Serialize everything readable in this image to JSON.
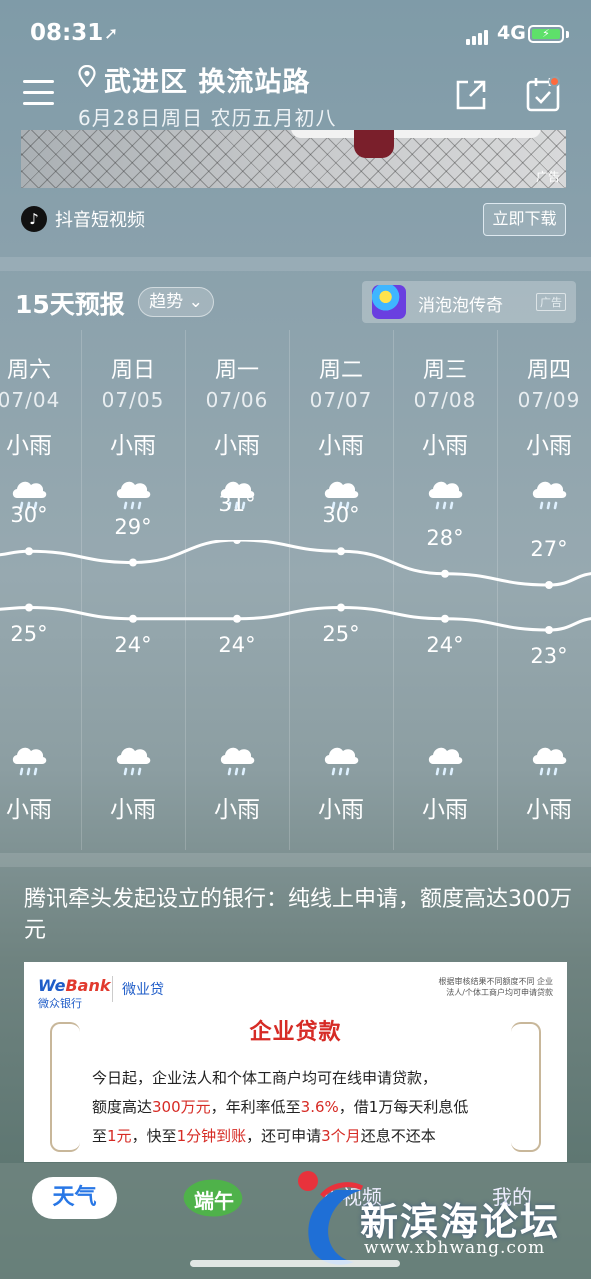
{
  "status_bar": {
    "time": "08:31",
    "network": "4G"
  },
  "header": {
    "location": "武进区 换流站路",
    "date_line": "6月28日周日 农历五月初八"
  },
  "ad_banner": {
    "ad_tag": "广告",
    "source_name": "抖音短视频",
    "download_label": "立即下载"
  },
  "forecast": {
    "title": "15天预报",
    "trend_label": "趋势",
    "game_ad": {
      "name": "消泡泡传奇",
      "ad_label": "广告"
    },
    "days": [
      {
        "weekday": "周六",
        "date": "07/04",
        "day_cond": "小雨",
        "night_cond": "小雨",
        "high": "30°",
        "low": "25°"
      },
      {
        "weekday": "周日",
        "date": "07/05",
        "day_cond": "小雨",
        "night_cond": "小雨",
        "high": "29°",
        "low": "24°"
      },
      {
        "weekday": "周一",
        "date": "07/06",
        "day_cond": "小雨",
        "night_cond": "小雨",
        "high": "31°",
        "low": "24°"
      },
      {
        "weekday": "周二",
        "date": "07/07",
        "day_cond": "小雨",
        "night_cond": "小雨",
        "high": "30°",
        "low": "25°"
      },
      {
        "weekday": "周三",
        "date": "07/08",
        "day_cond": "小雨",
        "night_cond": "小雨",
        "high": "28°",
        "low": "24°"
      },
      {
        "weekday": "周四",
        "date": "07/09",
        "day_cond": "小雨",
        "night_cond": "小雨",
        "high": "27°",
        "low": "23°"
      }
    ]
  },
  "chart_data": {
    "type": "line",
    "categories": [
      "07/04",
      "07/05",
      "07/06",
      "07/07",
      "07/08",
      "07/09"
    ],
    "series": [
      {
        "values": [
          30,
          29,
          31,
          30,
          28,
          27
        ]
      },
      {
        "values": [
          25,
          24,
          24,
          25,
          24,
          23
        ]
      }
    ],
    "ylim": [
      23,
      31
    ]
  },
  "news": {
    "title": "腾讯牵头发起设立的银行：纯线上申请，额度高达300万元",
    "card": {
      "brand_en_a": "We",
      "brand_en_b": "Bank",
      "brand_cn": "微众银行",
      "product": "微业贷",
      "note": "根据审核结果不同额度不同 企业法人/个体工商户均可申请贷款",
      "headline": "企业贷款",
      "body_1": "今日起，企业法人和个体工商户均可在线申请贷款，",
      "body_2a": "额度高达",
      "body_2b": "300万元",
      "body_2c": "，年利率低至",
      "body_2d": "3.6%",
      "body_2e": "，借1万每天利息低",
      "body_3a": "至",
      "body_3b": "1元",
      "body_3c": "，快至",
      "body_3d": "1分钟到账",
      "body_3e": "，还可申请",
      "body_3f": "3个月",
      "body_3g": "还息不还本"
    }
  },
  "bottom_nav": {
    "weather": "天气",
    "duanwu": "端午",
    "video": "小视频",
    "mine": "我的"
  },
  "watermark": {
    "text": "新滨海论坛",
    "url": "www.xbhwang.com"
  }
}
